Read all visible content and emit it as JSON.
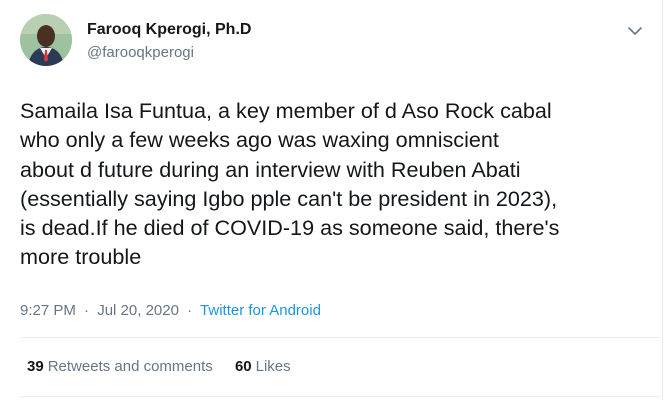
{
  "colors": {
    "text": "#14171a",
    "secondary": "#657786",
    "link": "#1b95e0",
    "border": "#e6ecf0"
  },
  "author": {
    "display_name": "Farooq Kperogi, Ph.D",
    "handle": "@farooqkperogi",
    "avatar_icon": "profile-photo"
  },
  "tweet": {
    "text": "Samaila Isa Funtua, a key member of d Aso Rock cabal\nwho only a few weeks ago was waxing omniscient\nabout d future during an interview with Reuben Abati\n(essentially saying Igbo pple can't be president in 2023),\nis dead.If he died of COVID-19 as someone said, there's\nmore trouble",
    "time": "9:27 PM",
    "date": "Jul 20, 2020",
    "separator": "·",
    "source": "Twitter for Android"
  },
  "stats": {
    "retweets_count": "39",
    "retweets_label": "Retweets and comments",
    "likes_count": "60",
    "likes_label": "Likes"
  },
  "icons": {
    "menu": "chevron-down-icon"
  }
}
